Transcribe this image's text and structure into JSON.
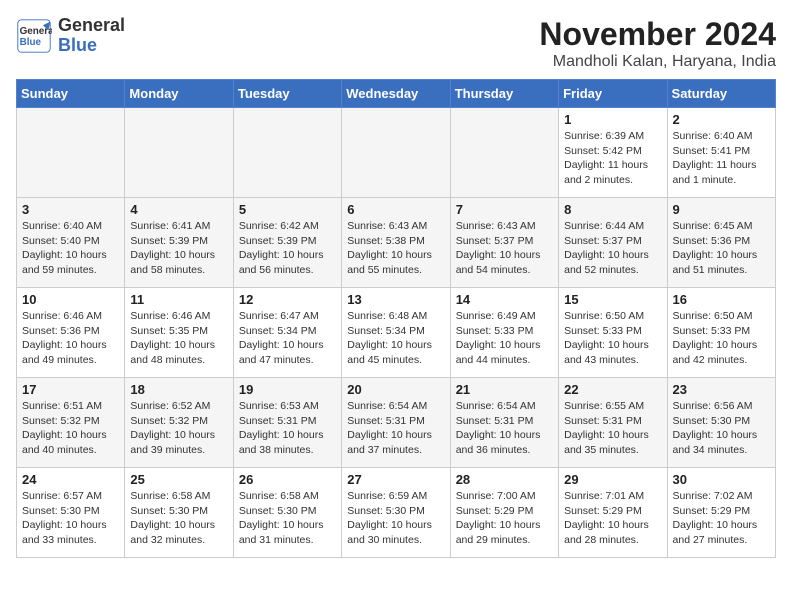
{
  "logo": {
    "text_line1": "General",
    "text_line2": "Blue"
  },
  "title": "November 2024",
  "subtitle": "Mandholi Kalan, Haryana, India",
  "days_of_week": [
    "Sunday",
    "Monday",
    "Tuesday",
    "Wednesday",
    "Thursday",
    "Friday",
    "Saturday"
  ],
  "weeks": [
    [
      {
        "day": "",
        "info": ""
      },
      {
        "day": "",
        "info": ""
      },
      {
        "day": "",
        "info": ""
      },
      {
        "day": "",
        "info": ""
      },
      {
        "day": "",
        "info": ""
      },
      {
        "day": "1",
        "info": "Sunrise: 6:39 AM\nSunset: 5:42 PM\nDaylight: 11 hours and 2 minutes."
      },
      {
        "day": "2",
        "info": "Sunrise: 6:40 AM\nSunset: 5:41 PM\nDaylight: 11 hours and 1 minute."
      }
    ],
    [
      {
        "day": "3",
        "info": "Sunrise: 6:40 AM\nSunset: 5:40 PM\nDaylight: 10 hours and 59 minutes."
      },
      {
        "day": "4",
        "info": "Sunrise: 6:41 AM\nSunset: 5:39 PM\nDaylight: 10 hours and 58 minutes."
      },
      {
        "day": "5",
        "info": "Sunrise: 6:42 AM\nSunset: 5:39 PM\nDaylight: 10 hours and 56 minutes."
      },
      {
        "day": "6",
        "info": "Sunrise: 6:43 AM\nSunset: 5:38 PM\nDaylight: 10 hours and 55 minutes."
      },
      {
        "day": "7",
        "info": "Sunrise: 6:43 AM\nSunset: 5:37 PM\nDaylight: 10 hours and 54 minutes."
      },
      {
        "day": "8",
        "info": "Sunrise: 6:44 AM\nSunset: 5:37 PM\nDaylight: 10 hours and 52 minutes."
      },
      {
        "day": "9",
        "info": "Sunrise: 6:45 AM\nSunset: 5:36 PM\nDaylight: 10 hours and 51 minutes."
      }
    ],
    [
      {
        "day": "10",
        "info": "Sunrise: 6:46 AM\nSunset: 5:36 PM\nDaylight: 10 hours and 49 minutes."
      },
      {
        "day": "11",
        "info": "Sunrise: 6:46 AM\nSunset: 5:35 PM\nDaylight: 10 hours and 48 minutes."
      },
      {
        "day": "12",
        "info": "Sunrise: 6:47 AM\nSunset: 5:34 PM\nDaylight: 10 hours and 47 minutes."
      },
      {
        "day": "13",
        "info": "Sunrise: 6:48 AM\nSunset: 5:34 PM\nDaylight: 10 hours and 45 minutes."
      },
      {
        "day": "14",
        "info": "Sunrise: 6:49 AM\nSunset: 5:33 PM\nDaylight: 10 hours and 44 minutes."
      },
      {
        "day": "15",
        "info": "Sunrise: 6:50 AM\nSunset: 5:33 PM\nDaylight: 10 hours and 43 minutes."
      },
      {
        "day": "16",
        "info": "Sunrise: 6:50 AM\nSunset: 5:33 PM\nDaylight: 10 hours and 42 minutes."
      }
    ],
    [
      {
        "day": "17",
        "info": "Sunrise: 6:51 AM\nSunset: 5:32 PM\nDaylight: 10 hours and 40 minutes."
      },
      {
        "day": "18",
        "info": "Sunrise: 6:52 AM\nSunset: 5:32 PM\nDaylight: 10 hours and 39 minutes."
      },
      {
        "day": "19",
        "info": "Sunrise: 6:53 AM\nSunset: 5:31 PM\nDaylight: 10 hours and 38 minutes."
      },
      {
        "day": "20",
        "info": "Sunrise: 6:54 AM\nSunset: 5:31 PM\nDaylight: 10 hours and 37 minutes."
      },
      {
        "day": "21",
        "info": "Sunrise: 6:54 AM\nSunset: 5:31 PM\nDaylight: 10 hours and 36 minutes."
      },
      {
        "day": "22",
        "info": "Sunrise: 6:55 AM\nSunset: 5:31 PM\nDaylight: 10 hours and 35 minutes."
      },
      {
        "day": "23",
        "info": "Sunrise: 6:56 AM\nSunset: 5:30 PM\nDaylight: 10 hours and 34 minutes."
      }
    ],
    [
      {
        "day": "24",
        "info": "Sunrise: 6:57 AM\nSunset: 5:30 PM\nDaylight: 10 hours and 33 minutes."
      },
      {
        "day": "25",
        "info": "Sunrise: 6:58 AM\nSunset: 5:30 PM\nDaylight: 10 hours and 32 minutes."
      },
      {
        "day": "26",
        "info": "Sunrise: 6:58 AM\nSunset: 5:30 PM\nDaylight: 10 hours and 31 minutes."
      },
      {
        "day": "27",
        "info": "Sunrise: 6:59 AM\nSunset: 5:30 PM\nDaylight: 10 hours and 30 minutes."
      },
      {
        "day": "28",
        "info": "Sunrise: 7:00 AM\nSunset: 5:29 PM\nDaylight: 10 hours and 29 minutes."
      },
      {
        "day": "29",
        "info": "Sunrise: 7:01 AM\nSunset: 5:29 PM\nDaylight: 10 hours and 28 minutes."
      },
      {
        "day": "30",
        "info": "Sunrise: 7:02 AM\nSunset: 5:29 PM\nDaylight: 10 hours and 27 minutes."
      }
    ]
  ]
}
